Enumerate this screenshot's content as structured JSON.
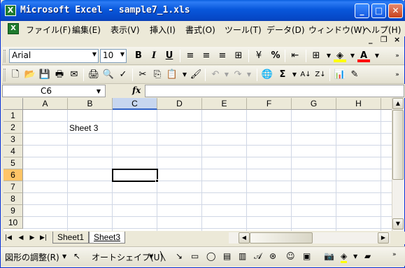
{
  "window": {
    "title": "Microsoft Excel - sample7_1.xls",
    "app_icon": "X",
    "min_label": "_",
    "max_label": "□",
    "close_label": "✕"
  },
  "menu": {
    "items": [
      "ファイル(F)",
      "編集(E)",
      "表示(V)",
      "挿入(I)",
      "書式(O)",
      "ツール(T)",
      "データ(D)",
      "ウィンドウ(W)",
      "ヘルプ(H)"
    ],
    "mdi_min": "_",
    "mdi_restore": "❐",
    "mdi_close": "×"
  },
  "format_toolbar": {
    "font_name": "Arial",
    "font_size": "10",
    "bold": "B",
    "italic": "I",
    "underline": "U",
    "percent": "%",
    "font_color_letter": "A"
  },
  "formula_bar": {
    "name_box": "C6",
    "fx": "fx",
    "value": ""
  },
  "sheet": {
    "columns": [
      "A",
      "B",
      "C",
      "D",
      "E",
      "F",
      "G",
      "H"
    ],
    "rows": [
      "1",
      "2",
      "3",
      "4",
      "5",
      "6",
      "7",
      "8",
      "9",
      "10"
    ],
    "selected_column": "C",
    "selected_row": "6",
    "cells": {
      "B2": "Sheet 3"
    }
  },
  "tabs": {
    "sheets": [
      "Sheet1",
      "Sheet3"
    ],
    "active": "Sheet3"
  },
  "draw_toolbar": {
    "adjust_label": "図形の調整(R)",
    "autoshape_label": "オートシェイプ(U)"
  },
  "colors": {
    "title_bar": "#0857db",
    "selection_header": "#c7d6ef",
    "selected_row_header": "#ffc466",
    "highlight_yellow": "#ffff00",
    "font_red": "#ff0000"
  }
}
